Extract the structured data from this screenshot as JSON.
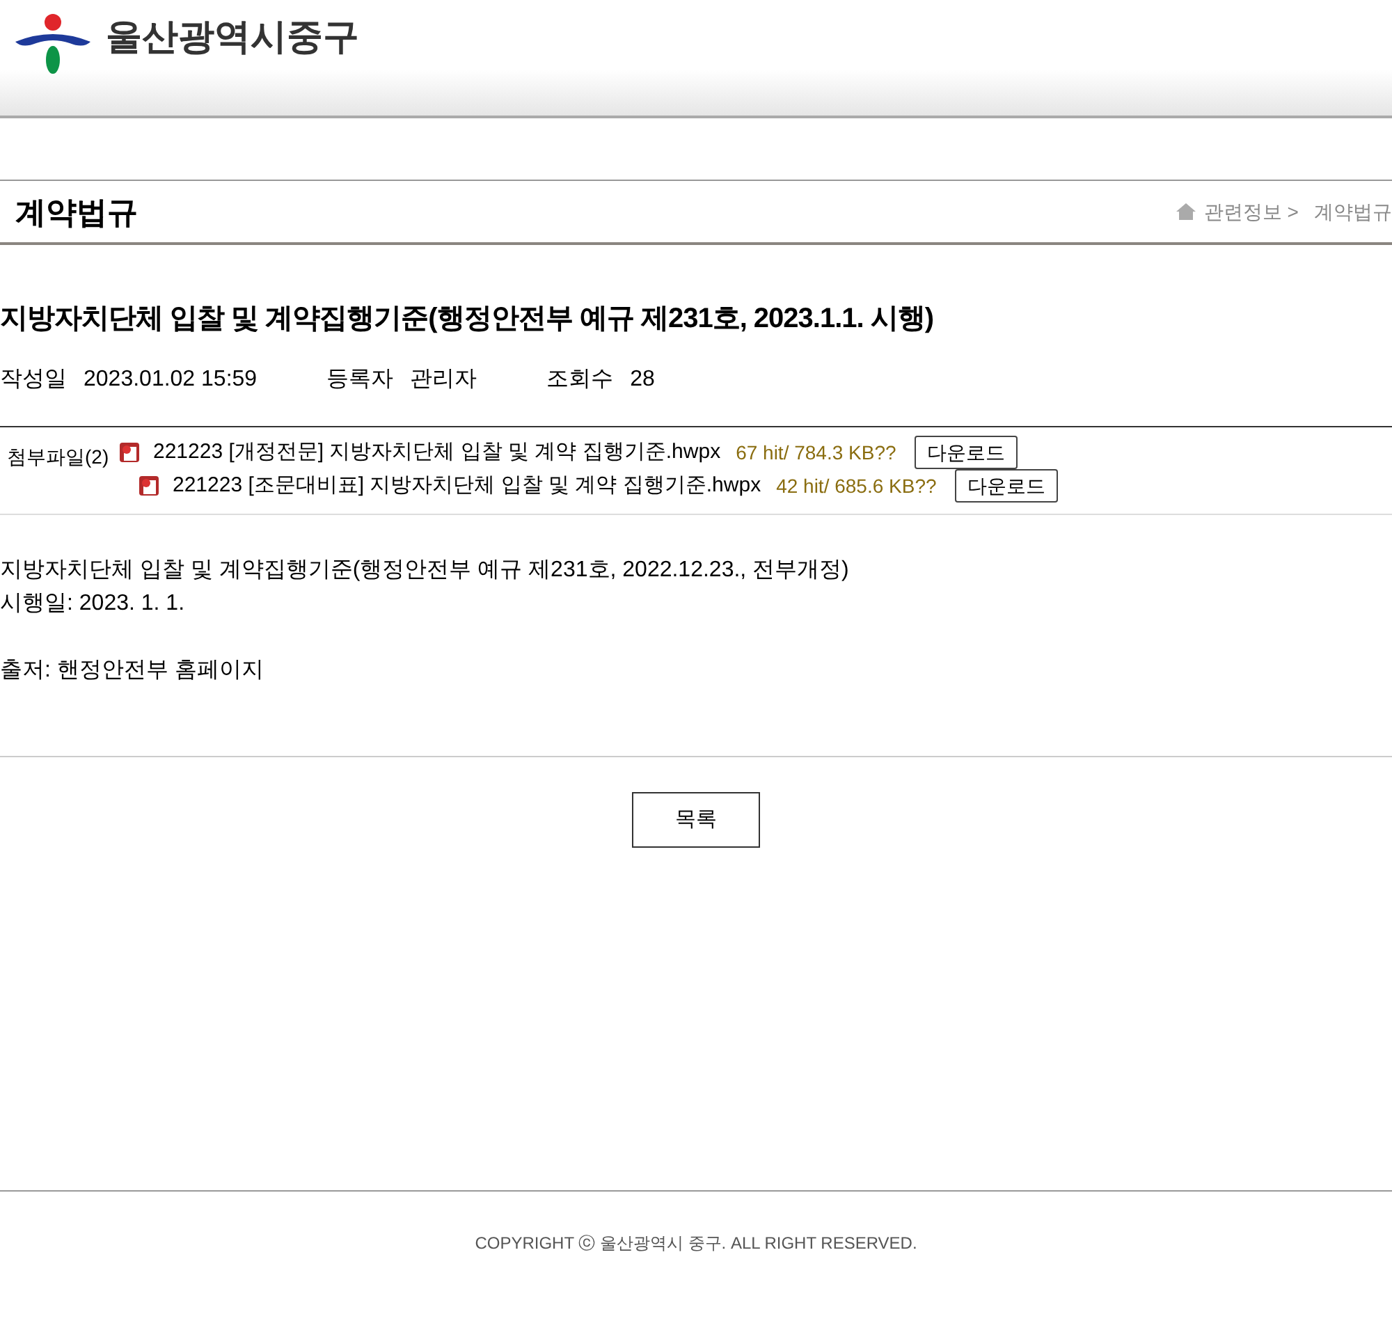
{
  "header": {
    "logo_text": "울산광역시중구"
  },
  "page_title": "계약법규",
  "breadcrumb": [
    "관련정보 >",
    "계약법규"
  ],
  "post": {
    "title": "지방자치단체 입찰 및 계약집행기준(행정안전부 예규 제231호, 2023.1.1. 시행)",
    "meta": [
      {
        "label": "작성일",
        "value": "2023.01.02 15:59"
      },
      {
        "label": "등록자",
        "value": "관리자"
      },
      {
        "label": "조회수",
        "value": "28"
      }
    ],
    "attachments_label": "첨부파일(2)",
    "attachments": [
      {
        "name": "221223 [개정전문] 지방자치단체 입찰 및 계약 집행기준.hwpx",
        "info": "67 hit/ 784.3 KB??",
        "button": "다운로드"
      },
      {
        "name": "221223 [조문대비표] 지방자치단체 입찰 및 계약 집행기준.hwpx",
        "info": "42 hit/ 685.6 KB??",
        "button": "다운로드"
      }
    ],
    "body": [
      [
        "지방자치단체 입찰 및 계약집행기준(행정안전부 예규 제231호, 2022.12.23., 전부개정)",
        "시행일: 2023. 1. 1."
      ],
      [
        "출저: 핸정안전부 홈페이지"
      ]
    ]
  },
  "list_button": "목록",
  "footer": "COPYRIGHT ⓒ 울산광역시 중구. ALL RIGHT RESERVED."
}
